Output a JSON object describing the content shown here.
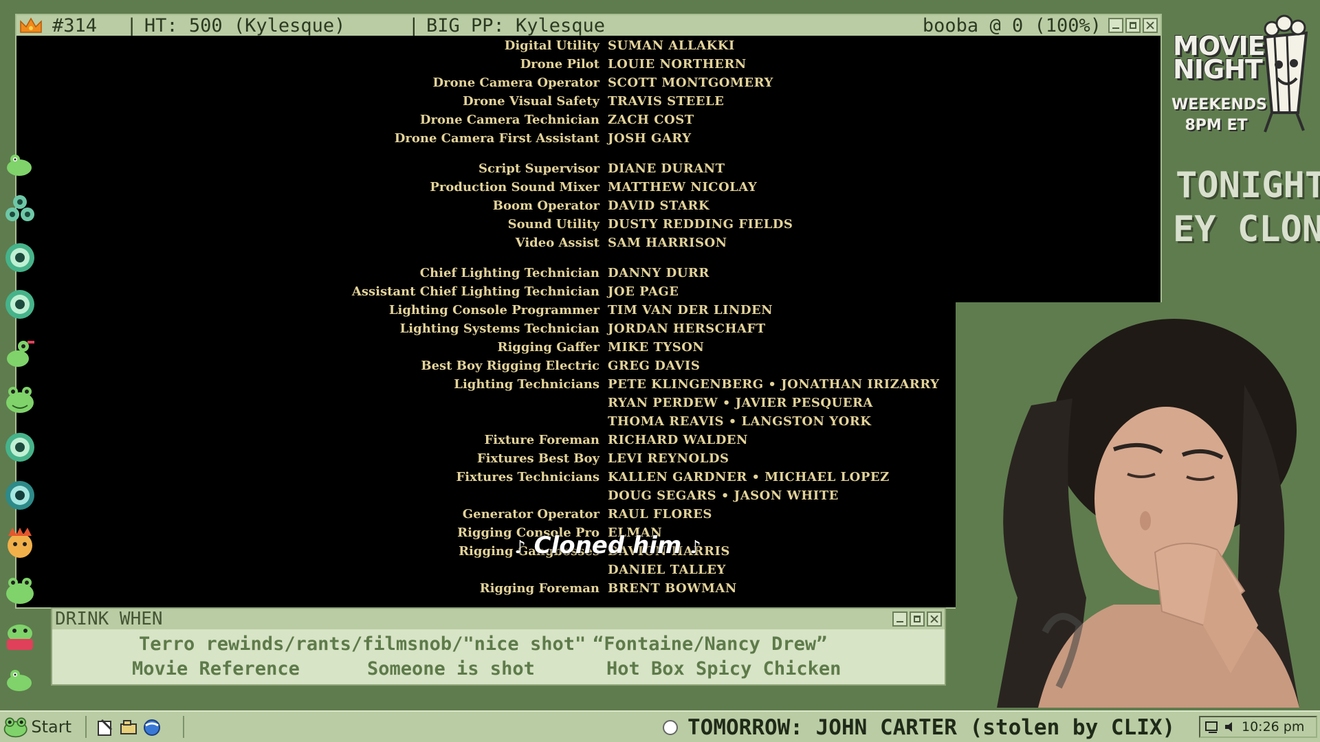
{
  "main_window": {
    "title_id": "#314",
    "title_ht": "HT: 500 (Kylesque)",
    "title_pp": "BIG PP: Kylesque",
    "title_right": "booba @ 0 (100%)"
  },
  "credits": [
    {
      "role": "Digital Utility",
      "name": "SUMAN ALLAKKI"
    },
    {
      "role": "Drone Pilot",
      "name": "LOUIE NORTHERN"
    },
    {
      "role": "Drone Camera Operator",
      "name": "SCOTT MONTGOMERY"
    },
    {
      "role": "Drone Visual Safety",
      "name": "TRAVIS STEELE"
    },
    {
      "role": "Drone Camera Technician",
      "name": "ZACH COST"
    },
    {
      "role": "Drone Camera First Assistant",
      "name": "JOSH GARY"
    },
    {
      "role": "Script Supervisor",
      "name": "DIANE DURANT"
    },
    {
      "role": "Production Sound Mixer",
      "name": "MATTHEW NICOLAY"
    },
    {
      "role": "Boom Operator",
      "name": "DAVID STARK"
    },
    {
      "role": "Sound Utility",
      "name": "DUSTY REDDING FIELDS"
    },
    {
      "role": "Video Assist",
      "name": "SAM HARRISON"
    },
    {
      "role": "Chief Lighting Technician",
      "name": "DANNY DURR"
    },
    {
      "role": "Assistant Chief Lighting Technician",
      "name": "JOE PAGE"
    },
    {
      "role": "Lighting Console Programmer",
      "name": "TIM VAN DER LINDEN"
    },
    {
      "role": "Lighting Systems Technician",
      "name": "JORDAN HERSCHAFT"
    },
    {
      "role": "Rigging Gaffer",
      "name": "MIKE TYSON"
    },
    {
      "role": "Best Boy Rigging Electric",
      "name": "GREG DAVIS"
    },
    {
      "role": "Lighting Technicians",
      "name": "PETE KLINGENBERG • JONATHAN IRIZARRY"
    },
    {
      "role": "",
      "name": "RYAN PERDEW • JAVIER PESQUERA"
    },
    {
      "role": "",
      "name": "THOMA REAVIS • LANGSTON YORK"
    },
    {
      "role": "Fixture Foreman",
      "name": "RICHARD WALDEN"
    },
    {
      "role": "Fixtures Best Boy",
      "name": "LEVI REYNOLDS"
    },
    {
      "role": "Fixtures Technicians",
      "name": "KALLEN GARDNER • MICHAEL LOPEZ"
    },
    {
      "role": "",
      "name": "DOUG SEGARS • JASON WHITE"
    },
    {
      "role": "Generator Operator",
      "name": "RAUL FLORES"
    },
    {
      "role": "Rigging Console Pro",
      "name": "ELMAN"
    },
    {
      "role": "Rigging Gangbosses",
      "name": "DAVION HARRIS"
    },
    {
      "role": "",
      "name": "DANIEL TALLEY"
    },
    {
      "role": "Rigging Foreman",
      "name": "BRENT BOWMAN"
    }
  ],
  "caption": {
    "note_left": "♪",
    "text": "Cloned him",
    "note_right": "♪"
  },
  "drink_when": {
    "title": "DRINK WHEN",
    "rules": [
      "Terro rewinds/rants/filmsnob/\"nice shot\"",
      "“Fontaine/Nancy Drew”",
      "Movie Reference",
      "Someone is shot",
      "Hot Box Spicy Chicken"
    ]
  },
  "panel": {
    "logo_line1": "MOVIE",
    "logo_line2": "NIGHT",
    "schedule_line1": "WEEKENDS",
    "schedule_line2": "8PM ET",
    "tonight_label": "TONIGHT:",
    "tonight_movie": "EY CLONE"
  },
  "taskbar": {
    "start_label": "Start",
    "ticker": "TOMORROW: JOHN CARTER (stolen by CLIX)",
    "clock": "10:26 pm"
  },
  "colors": {
    "background": "#5f7c4e",
    "window_chrome": "#b9cca3",
    "credits_text": "#e3d39a",
    "drink_text": "#5e7a4a"
  },
  "icons": [
    "crown-icon",
    "frog-emote-icon",
    "minimize-icon",
    "maximize-icon",
    "close-icon",
    "popcorn-mascot-icon",
    "start-frog-icon",
    "notepad-icon",
    "explorer-icon",
    "browser-icon",
    "network-icon",
    "speaker-icon"
  ]
}
